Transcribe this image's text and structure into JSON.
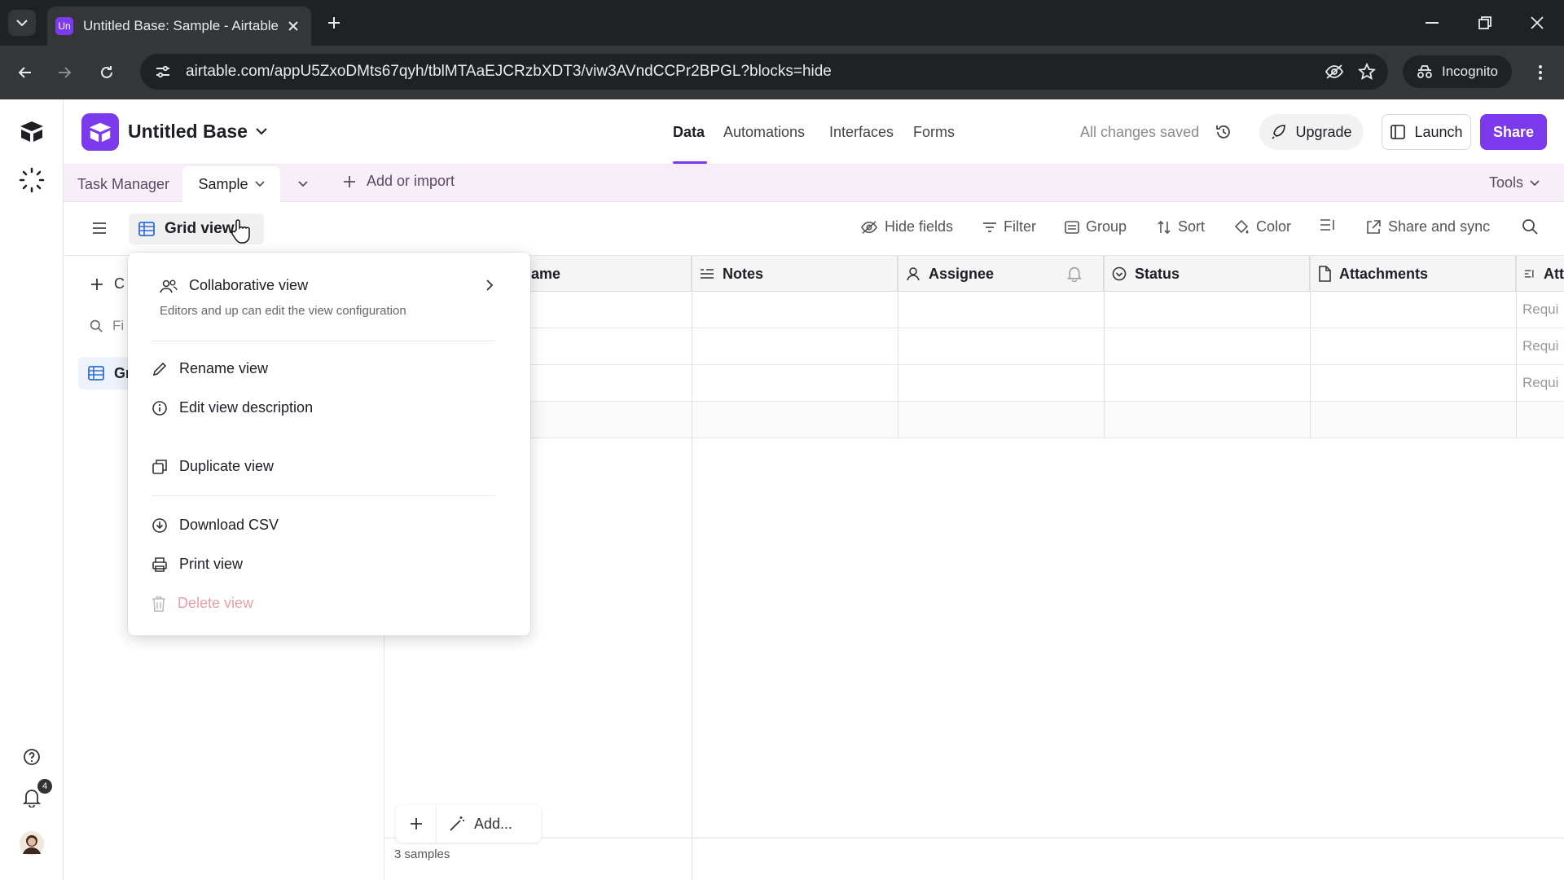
{
  "browser": {
    "tab_favicon": "Un",
    "tab_title": "Untitled Base: Sample - Airtable",
    "url": "airtable.com/appU5ZxoDMts67qyh/tblMTAaEJCRzbXDT3/viw3AVndCCPr2BPGL?blocks=hide",
    "incognito_label": "Incognito"
  },
  "app": {
    "base_name": "Untitled Base",
    "nav_tabs": [
      "Data",
      "Automations",
      "Interfaces",
      "Forms"
    ],
    "active_nav": "Data",
    "save_status": "All changes saved",
    "upgrade_label": "Upgrade",
    "launch_label": "Launch",
    "share_label": "Share",
    "accent_color": "#7c3aed",
    "notifications_count": "4"
  },
  "tables": {
    "items": [
      "Task Manager",
      "Sample"
    ],
    "active": "Sample",
    "add_label": "Add or import",
    "tools_label": "Tools"
  },
  "viewbar": {
    "view_name": "Grid view",
    "tools": [
      "Hide fields",
      "Filter",
      "Group",
      "Sort",
      "Color",
      "Share and sync"
    ]
  },
  "sidebar": {
    "create_label": "C",
    "find_placeholder": "Fi",
    "view_item": "Gr"
  },
  "grid": {
    "columns": [
      "ame",
      "Notes",
      "Assignee",
      "Status",
      "Attachments",
      "Att"
    ],
    "rows": [
      {
        "last": "Requi"
      },
      {
        "last": "Requi"
      },
      {
        "last": "Requi"
      }
    ],
    "add_label": "Add...",
    "record_count": "3 samples"
  },
  "view_menu": {
    "collab_title": "Collaborative view",
    "collab_sub": "Editors and up can edit the view configuration",
    "items": [
      "Rename view",
      "Edit view description",
      "Duplicate view",
      "Download CSV",
      "Print view",
      "Delete view"
    ]
  }
}
